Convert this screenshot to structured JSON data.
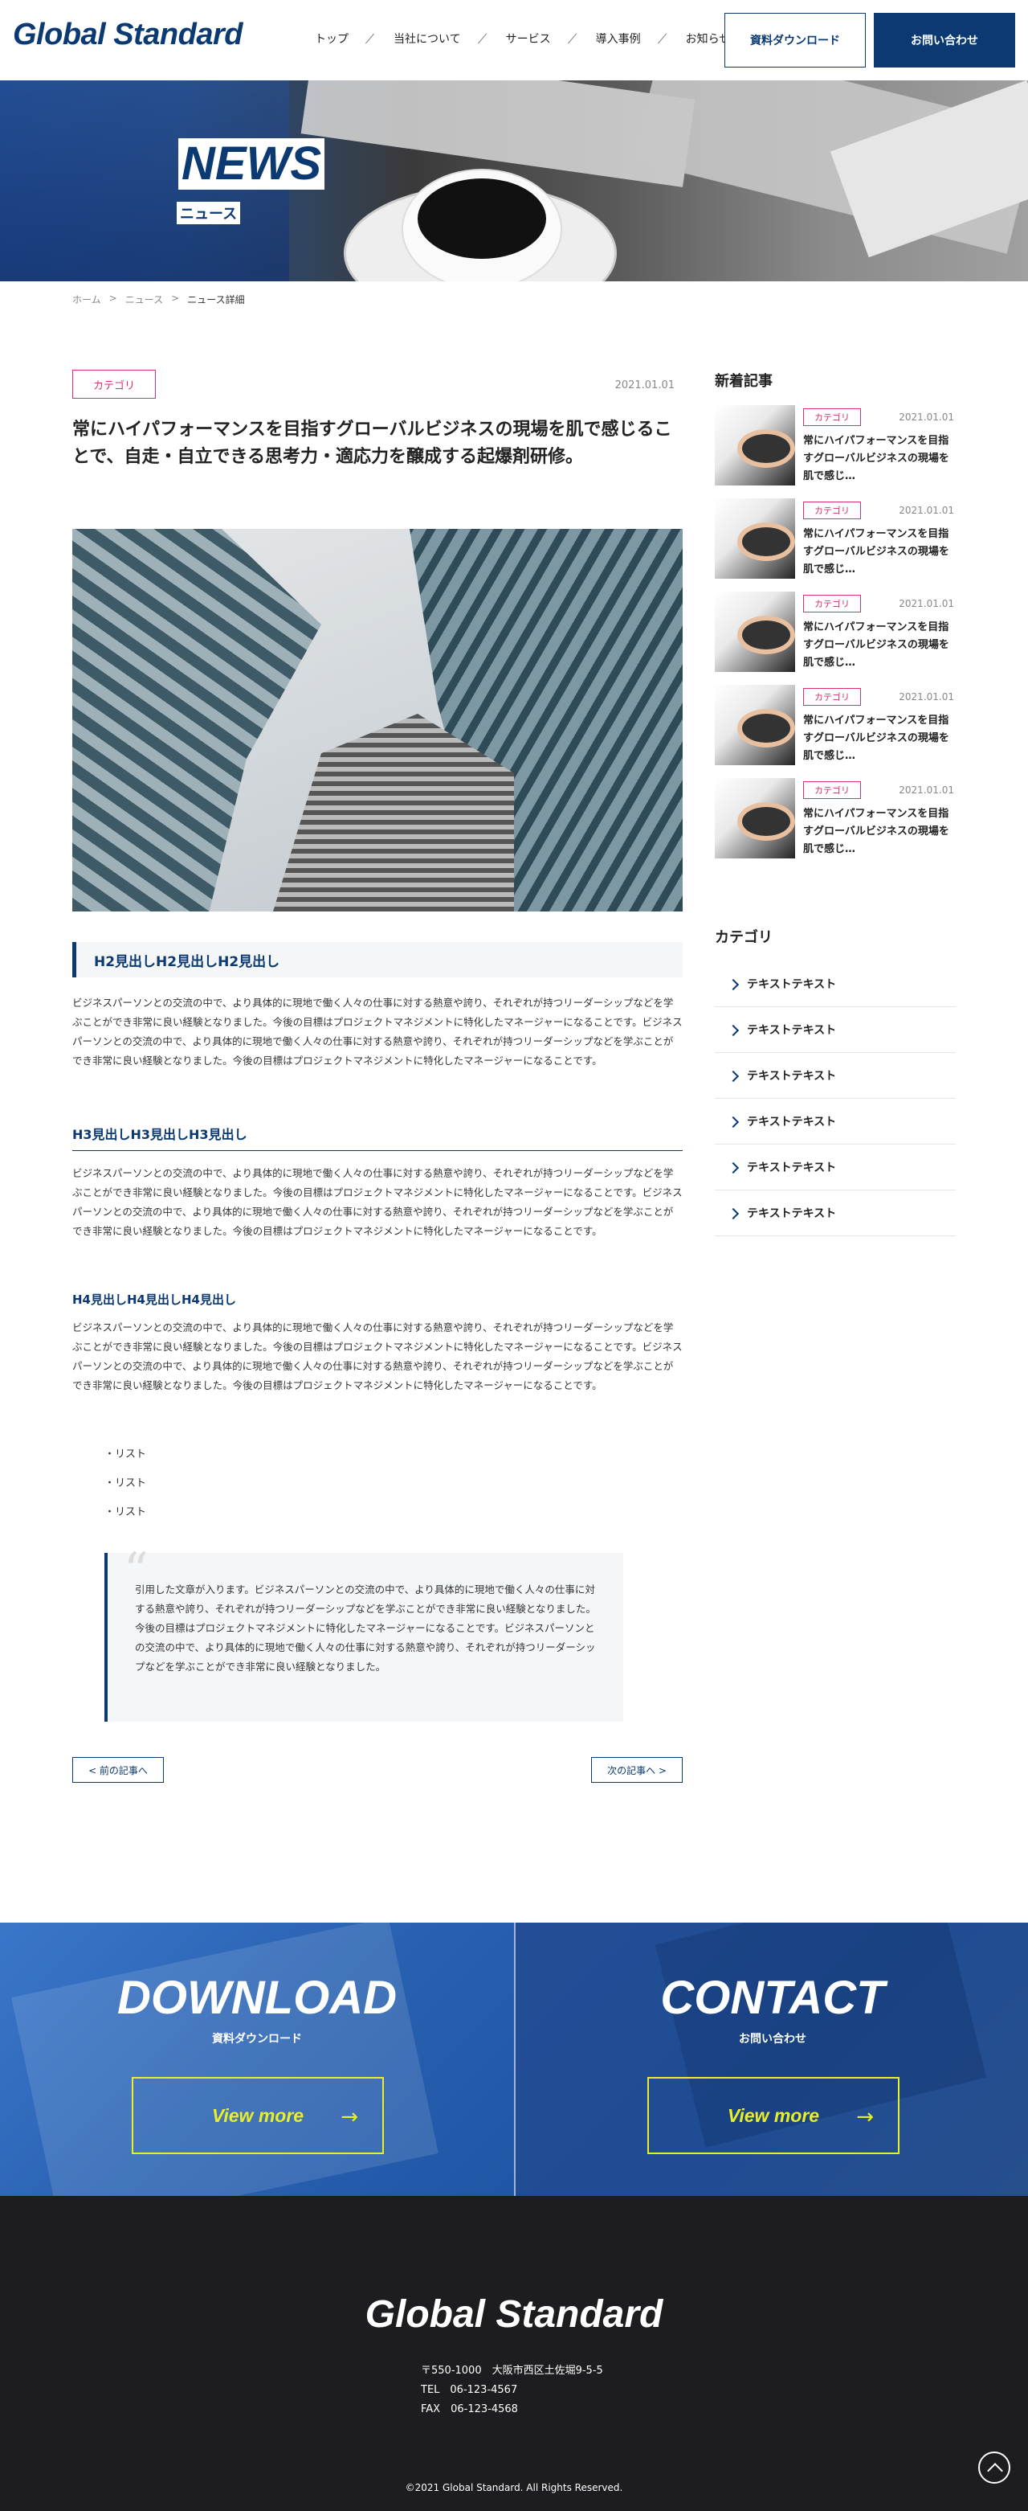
{
  "brand": {
    "logo": "Global Standard",
    "primary": "#0b3a73",
    "accent": "#d9306f",
    "cta_yellow": "#e8ef2a",
    "footer_bg": "#1d1d1f"
  },
  "nav": {
    "items": [
      "トップ",
      "当社について",
      "サービス",
      "導入事例",
      "お知らせ"
    ],
    "download_label": "資料ダウンロード",
    "contact_label": "お問い合わせ"
  },
  "hero": {
    "title": "NEWS",
    "subtitle": "ニュース"
  },
  "breadcrumb": {
    "home": "ホーム",
    "news": "ニュース",
    "current": "ニュース詳細",
    "sep": ">"
  },
  "post": {
    "category": "カテゴリ",
    "date": "2021.01.01",
    "title": "常にハイパフォーマンスを目指すグローバルビジネスの現場を肌で感じることで、自走・自立できる思考力・適応力を醸成する起爆剤研修。",
    "h2": "H2見出しH2見出しH2見出し",
    "p1": "ビジネスパーソンとの交流の中で、より具体的に現地で働く人々の仕事に対する熱意や誇り、それぞれが持つリーダーシップなどを学ぶことができ非常に良い経験となりました。今後の目標はプロジェクトマネジメントに特化したマネージャーになることです。ビジネスパーソンとの交流の中で、より具体的に現地で働く人々の仕事に対する熱意や誇り、それぞれが持つリーダーシップなどを学ぶことができ非常に良い経験となりました。今後の目標はプロジェクトマネジメントに特化したマネージャーになることです。",
    "h3": "H3見出しH3見出しH3見出し",
    "p2": "ビジネスパーソンとの交流の中で、より具体的に現地で働く人々の仕事に対する熱意や誇り、それぞれが持つリーダーシップなどを学ぶことができ非常に良い経験となりました。今後の目標はプロジェクトマネジメントに特化したマネージャーになることです。ビジネスパーソンとの交流の中で、より具体的に現地で働く人々の仕事に対する熱意や誇り、それぞれが持つリーダーシップなどを学ぶことができ非常に良い経験となりました。今後の目標はプロジェクトマネジメントに特化したマネージャーになることです。",
    "h4": "H4見出しH4見出しH4見出し",
    "p3": "ビジネスパーソンとの交流の中で、より具体的に現地で働く人々の仕事に対する熱意や誇り、それぞれが持つリーダーシップなどを学ぶことができ非常に良い経験となりました。今後の目標はプロジェクトマネジメントに特化したマネージャーになることです。ビジネスパーソンとの交流の中で、より具体的に現地で働く人々の仕事に対する熱意や誇り、それぞれが持つリーダーシップなどを学ぶことができ非常に良い経験となりました。今後の目標はプロジェクトマネジメントに特化したマネージャーになることです。",
    "list": [
      "・リスト",
      "・リスト",
      "・リスト"
    ],
    "quote_mark": "“",
    "quote": "引用した文章が入ります。ビジネスパーソンとの交流の中で、より具体的に現地で働く人々の仕事に対する熱意や誇り、それぞれが持つリーダーシップなどを学ぶことができ非常に良い経験となりました。今後の目標はプロジェクトマネジメントに特化したマネージャーになることです。ビジネスパーソンとの交流の中で、より具体的に現地で働く人々の仕事に対する熱意や誇り、それぞれが持つリーダーシップなどを学ぶことができ非常に良い経験となりました。",
    "prev": "< 前の記事へ",
    "next": "次の記事へ >"
  },
  "sidebar": {
    "recent_heading": "新着記事",
    "recent": [
      {
        "category": "カテゴリ",
        "date": "2021.01.01",
        "title": "常にハイパフォーマンスを目指すグローバルビジネスの現場を肌で感じ…"
      },
      {
        "category": "カテゴリ",
        "date": "2021.01.01",
        "title": "常にハイパフォーマンスを目指すグローバルビジネスの現場を肌で感じ…"
      },
      {
        "category": "カテゴリ",
        "date": "2021.01.01",
        "title": "常にハイパフォーマンスを目指すグローバルビジネスの現場を肌で感じ…"
      },
      {
        "category": "カテゴリ",
        "date": "2021.01.01",
        "title": "常にハイパフォーマンスを目指すグローバルビジネスの現場を肌で感じ…"
      },
      {
        "category": "カテゴリ",
        "date": "2021.01.01",
        "title": "常にハイパフォーマンスを目指すグローバルビジネスの現場を肌で感じ…"
      }
    ],
    "category_heading": "カテゴリ",
    "categories": [
      "テキストテキスト",
      "テキストテキスト",
      "テキストテキスト",
      "テキストテキスト",
      "テキストテキスト",
      "テキストテキスト"
    ]
  },
  "cta": {
    "download": {
      "title": "DOWNLOAD",
      "subtitle": "資料ダウンロード",
      "button": "View more"
    },
    "contact": {
      "title": "CONTACT",
      "subtitle": "お問い合わせ",
      "button": "View more"
    }
  },
  "footer": {
    "logo": "Global Standard",
    "address": "〒550-1000　大阪市西区土佐堀9-5-5",
    "tel": "TEL　06-123-4567",
    "fax": "FAX　06-123-4568",
    "copyright": "©2021 Global Standard. All Rights Reserved."
  }
}
